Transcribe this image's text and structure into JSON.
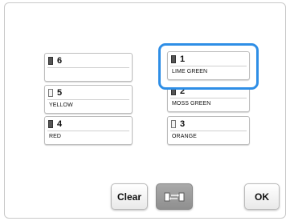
{
  "cards": [
    {
      "number": "6",
      "name": "",
      "spool": "dark"
    },
    {
      "number": "1",
      "name": "LIME GREEN",
      "spool": "dark"
    },
    {
      "number": "5",
      "name": "YELLOW",
      "spool": "light"
    },
    {
      "number": "2",
      "name": "MOSS GREEN",
      "spool": "dark"
    },
    {
      "number": "4",
      "name": "RED",
      "spool": "dark"
    },
    {
      "number": "3",
      "name": "ORANGE",
      "spool": "light"
    }
  ],
  "buttons": {
    "clear_label": "Clear",
    "swap_icon": "thread-swap-icon",
    "ok_label": "OK"
  },
  "colors": {
    "highlight": "#2e8ee6",
    "swap_button": "#9b9b9b"
  }
}
